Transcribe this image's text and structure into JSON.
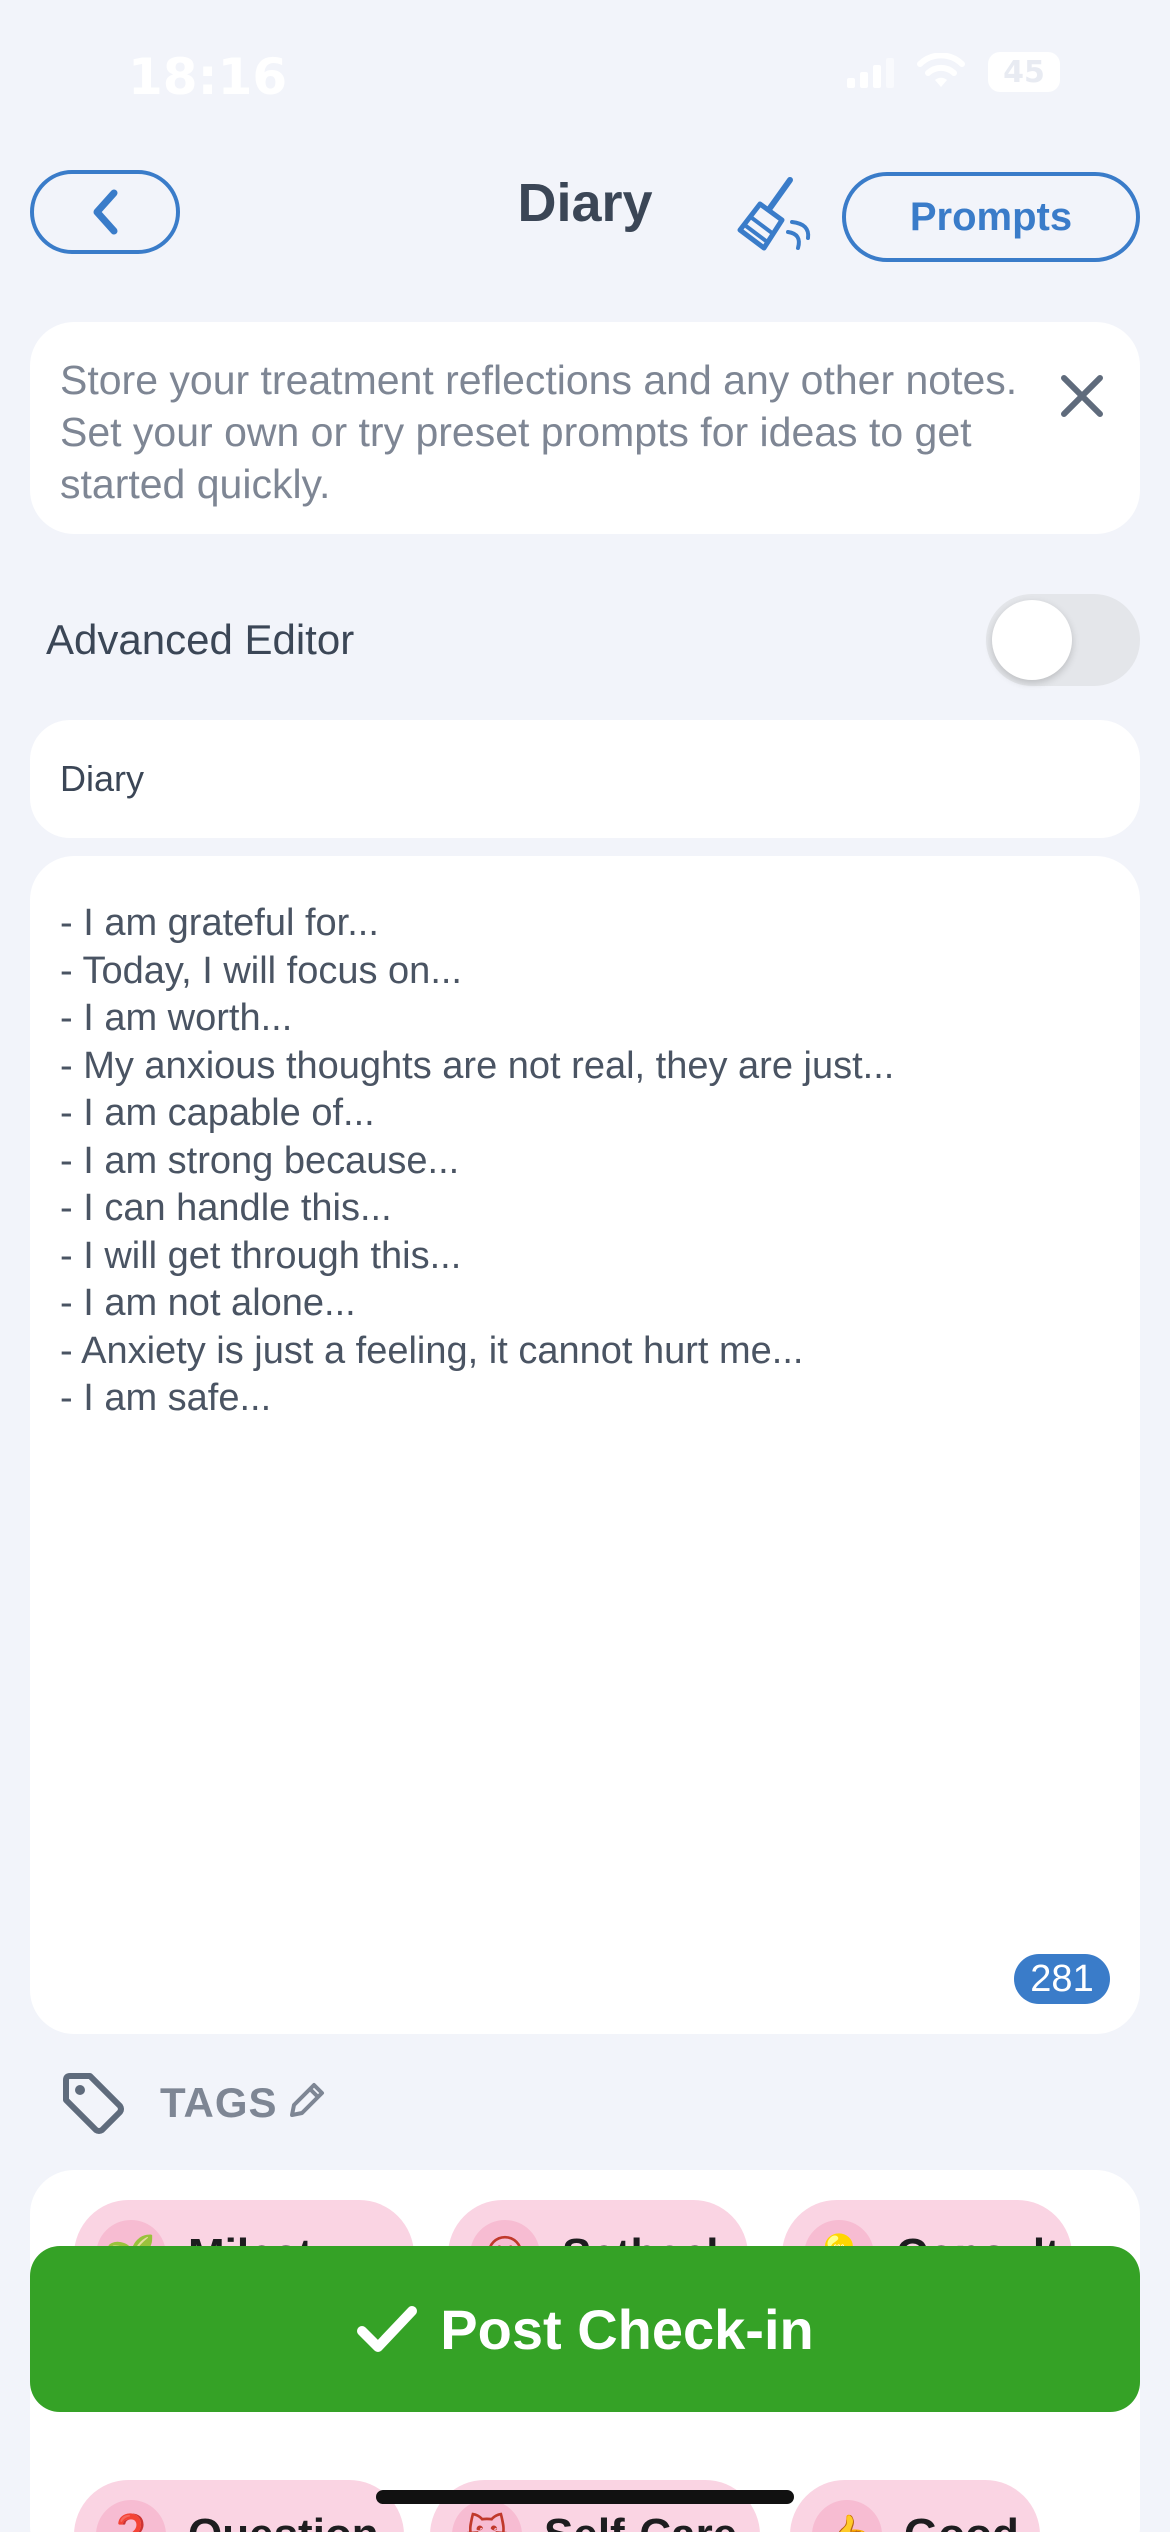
{
  "status_bar": {
    "time": "18:16",
    "battery": "45"
  },
  "header": {
    "title": "Diary",
    "prompts_label": "Prompts"
  },
  "info": {
    "text": "Store your treatment reflections and any other notes. Set your own or try preset prompts for ideas to get started quickly."
  },
  "advanced_editor": {
    "label": "Advanced Editor",
    "enabled": false
  },
  "entry": {
    "title": "Diary",
    "lines": [
      "- I am grateful for...",
      "- Today, I will focus on...",
      "- I am worth...",
      "- My anxious thoughts are not real, they are just...",
      "- I am capable of...",
      "- I am strong because...",
      "- I can handle this...",
      "- I will get through this...",
      "- I am not alone...",
      "- Anxiety is just a feeling, it cannot hurt me...",
      "- I am safe..."
    ],
    "char_count": "281"
  },
  "tags": {
    "label": "TAGS",
    "chips": [
      {
        "label": "Milest",
        "icon": "🌱"
      },
      {
        "label": "Setback",
        "icon": "😮"
      },
      {
        "label": "Consult",
        "icon": "💡"
      },
      {
        "label": "Question",
        "icon": "❓"
      },
      {
        "label": "Self-Care",
        "icon": "😺"
      },
      {
        "label": "Good",
        "icon": "👍"
      }
    ]
  },
  "post_button": {
    "label": "Post Check-in"
  },
  "colors": {
    "accent": "#3a7cc9",
    "success": "#35a226",
    "chip": "#fad4e3",
    "background": "#f2f4fa"
  }
}
